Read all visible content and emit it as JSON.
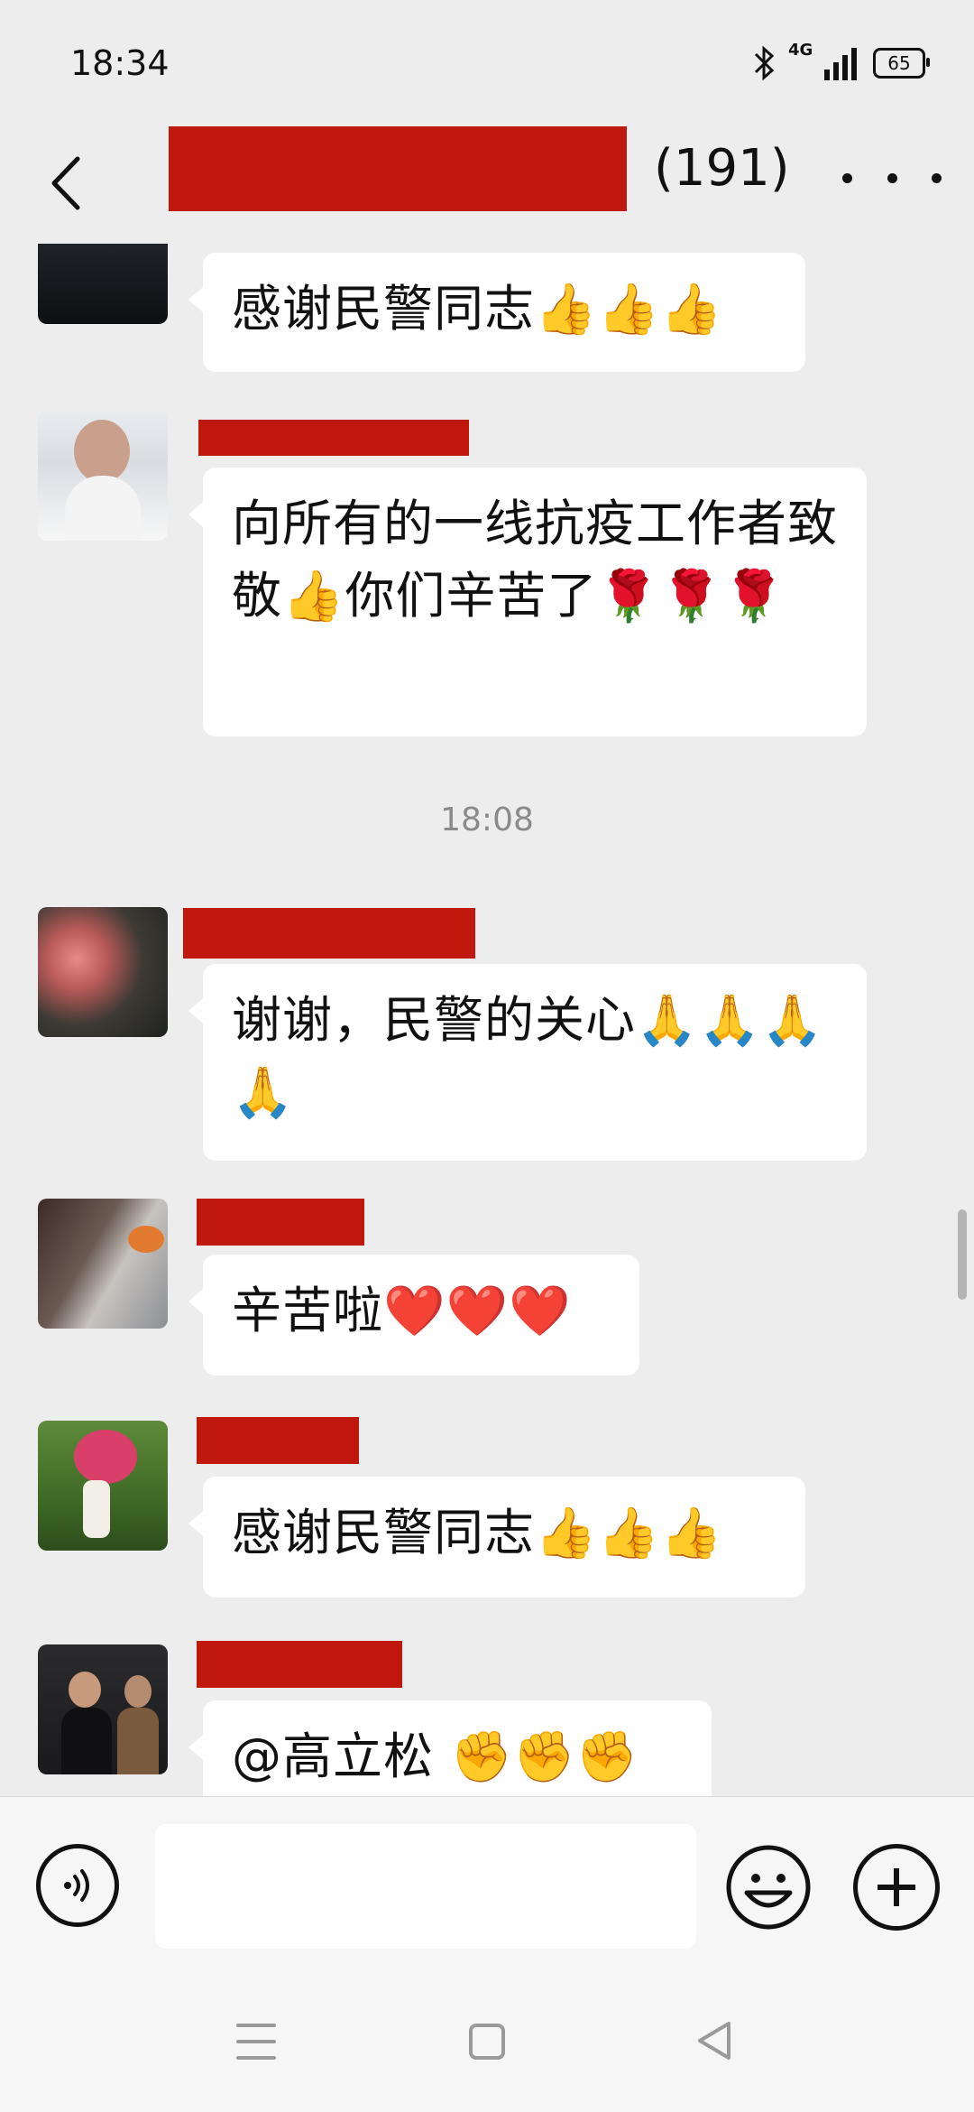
{
  "status_bar": {
    "time": "18:34",
    "network": "4G",
    "battery": "65"
  },
  "header": {
    "member_count": "(191)"
  },
  "messages": [
    {
      "text": "感谢民警同志👍👍👍"
    },
    {
      "text": "向所有的一线抗疫工作者致敬👍你们辛苦了🌹🌹🌹"
    },
    {
      "text": "谢谢，民警的关心🙏🙏🙏🙏"
    },
    {
      "text": "辛苦啦❤️❤️❤️"
    },
    {
      "text": "感谢民警同志👍👍👍"
    },
    {
      "text": "@高立松 ✊✊✊"
    }
  ],
  "timestamp": "18:08",
  "colors": {
    "redaction": "#c0180c",
    "background": "#ededed",
    "bubble": "#ffffff"
  },
  "icons": {
    "back": "chevron-left-icon",
    "more": "more-dots-icon",
    "voice": "voice-icon",
    "emoji": "emoji-icon",
    "plus": "plus-icon"
  }
}
